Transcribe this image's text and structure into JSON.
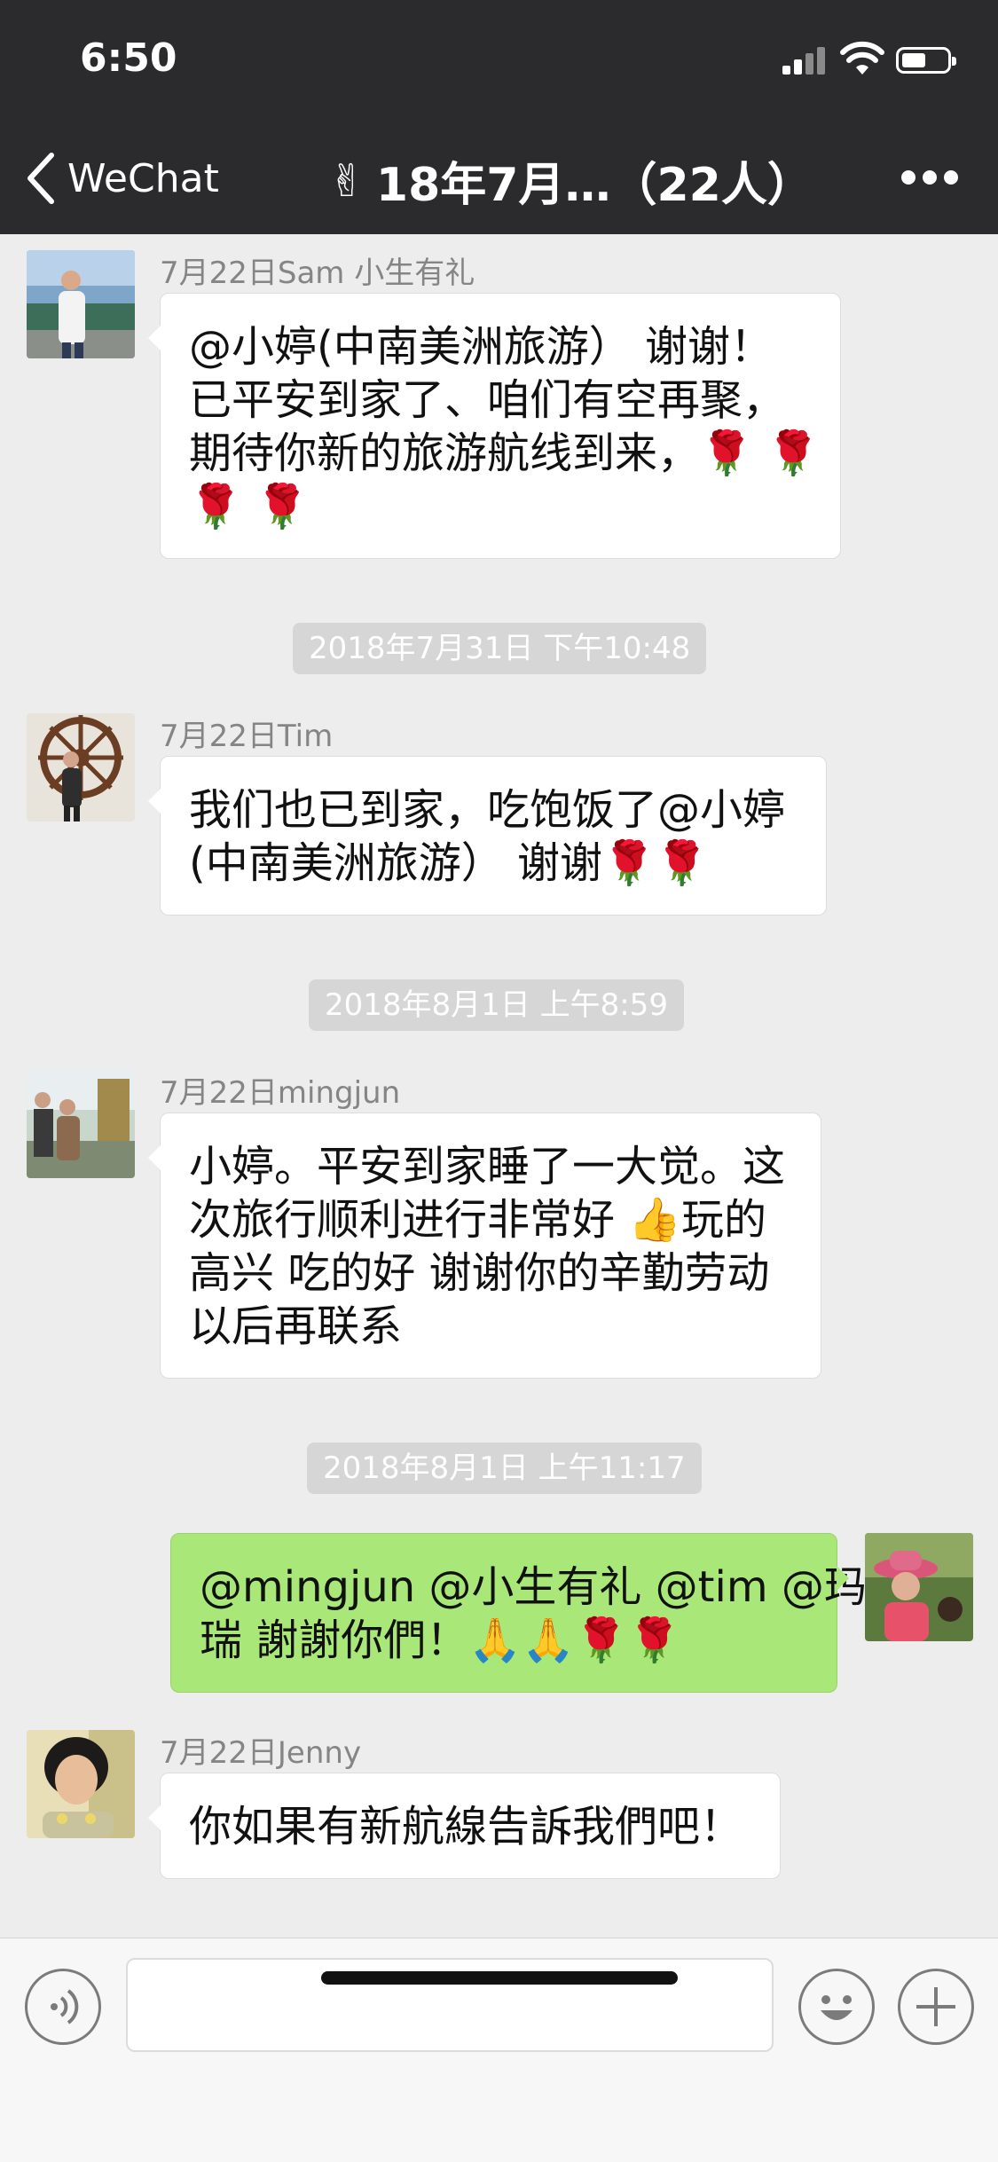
{
  "status_bar": {
    "time": "6:50",
    "signal_icon": "cellular-signal-icon",
    "wifi_icon": "wifi-icon",
    "battery_icon": "battery-icon"
  },
  "nav": {
    "back_label": "WeChat",
    "title_emoji": "✌",
    "title": "18年7月…（22人）",
    "more_icon": "ellipsis-icon"
  },
  "messages": [
    {
      "sender": "7月22日Sam 小生有礼",
      "lines": [
        "@小婷(中南美洲旅游） 谢谢！",
        "已平安到家了、咱们有空再聚，",
        "期待你新的旅游航线到来，🌹 🌹",
        "🌹 🌹"
      ]
    },
    {
      "timestamp": "2018年7月31日 下午10:48"
    },
    {
      "sender": "7月22日Tim",
      "lines": [
        "我们也已到家，吃饱饭了@小婷",
        "(中南美洲旅游） 谢谢🌹🌹"
      ]
    },
    {
      "timestamp": "2018年8月1日 上午8:59"
    },
    {
      "sender": "7月22日mingjun",
      "lines": [
        "小婷。平安到家睡了一大觉。这",
        "次旅行顺利进行非常好 👍玩的",
        "高兴 吃的好 谢谢你的辛勤劳动",
        "以后再联系"
      ]
    },
    {
      "timestamp": "2018年8月1日 上午11:17"
    },
    {
      "sender": "me",
      "lines": [
        "@mingjun @小生有礼 @tim @玛",
        "瑞  謝謝你們！🙏🙏🌹🌹"
      ]
    },
    {
      "sender": "7月22日Jenny",
      "lines": [
        "你如果有新航線告訴我們吧！"
      ]
    }
  ],
  "input_bar": {
    "voice_icon": "voice-icon",
    "input_value": "",
    "emoji_icon": "emoji-icon",
    "plus_icon": "plus-icon"
  },
  "colors": {
    "nav_background": "#2b2b2d",
    "chat_background": "#ededed",
    "outgoing_bubble": "#a9e878",
    "incoming_bubble": "#ffffff",
    "timestamp_pill": "#d6d6d6"
  }
}
